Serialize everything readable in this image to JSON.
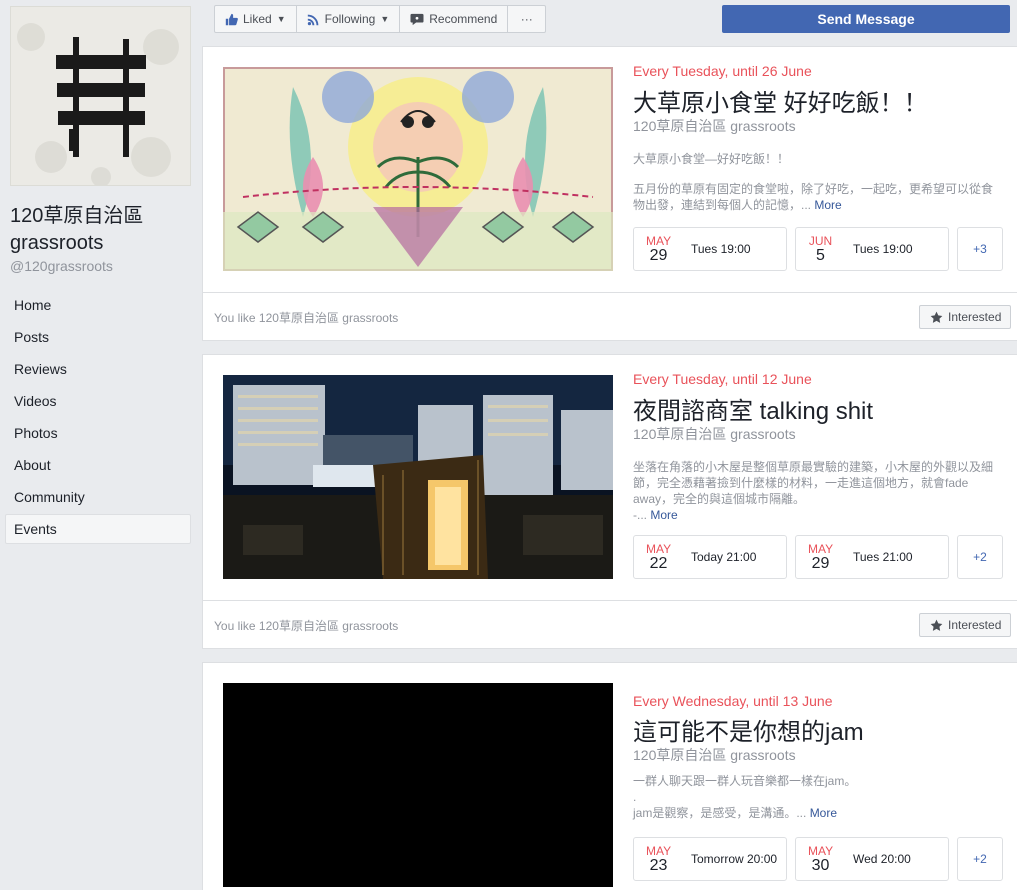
{
  "page": {
    "name_line1": "120草原自治區",
    "name_line2": "grassroots",
    "handle": "@120grassroots"
  },
  "nav": [
    {
      "label": "Home",
      "active": false
    },
    {
      "label": "Posts",
      "active": false
    },
    {
      "label": "Reviews",
      "active": false
    },
    {
      "label": "Videos",
      "active": false
    },
    {
      "label": "Photos",
      "active": false
    },
    {
      "label": "About",
      "active": false
    },
    {
      "label": "Community",
      "active": false
    },
    {
      "label": "Events",
      "active": true
    }
  ],
  "toolbar": {
    "liked_label": "Liked",
    "following_label": "Following",
    "recommend_label": "Recommend",
    "more_label": "···",
    "send_message_label": "Send Message"
  },
  "events": [
    {
      "recurrence": "Every Tuesday, until 26 June",
      "title": "大草原小食堂 好好吃飯！！",
      "host": "120草原自治區 grassroots",
      "desc_lines": [
        "大草原小食堂—好好吃飯！！",
        "五月份的草原有固定的食堂啦，除了好吃，一起吃，更希望可以從食物出發，連結到每個人的記憶，..."
      ],
      "more_label": "More",
      "dates": [
        {
          "month": "MAY",
          "day": "29",
          "time": "Tues 19:00"
        },
        {
          "month": "JUN",
          "day": "5",
          "time": "Tues 19:00"
        }
      ],
      "extra_count": "+3",
      "footer_text": "You like 120草原自治區 grassroots",
      "interested_label": "Interested"
    },
    {
      "recurrence": "Every Tuesday, until 12 June",
      "title": "夜間諮商室 talking shit",
      "host": "120草原自治區 grassroots",
      "desc_lines": [
        "坐落在角落的小木屋是整個草原最實驗的建築，小木屋的外觀以及細節，完全憑藉著撿到什麼樣的材料，一走進這個地方，就會fade away，完全的與這個城市隔離。",
        "-..."
      ],
      "more_label": "More",
      "dates": [
        {
          "month": "MAY",
          "day": "22",
          "time": "Today 21:00"
        },
        {
          "month": "MAY",
          "day": "29",
          "time": "Tues 21:00"
        }
      ],
      "extra_count": "+2",
      "footer_text": "You like 120草原自治區 grassroots",
      "interested_label": "Interested"
    },
    {
      "recurrence": "Every Wednesday, until 13 June",
      "title": "這可能不是你想的jam",
      "host": "120草原自治區 grassroots",
      "desc_lines": [
        "一群人聊天跟一群人玩音樂都一樣在jam。",
        ".",
        "jam是觀察，是感受，是溝通。..."
      ],
      "more_label": "More",
      "dates": [
        {
          "month": "MAY",
          "day": "23",
          "time": "Tomorrow 20:00"
        },
        {
          "month": "MAY",
          "day": "30",
          "time": "Wed 20:00"
        }
      ],
      "extra_count": "+2"
    }
  ],
  "colors": {
    "accent": "#4267b2",
    "recurrence": "#e9525a",
    "muted": "#90949c",
    "link": "#365899"
  }
}
